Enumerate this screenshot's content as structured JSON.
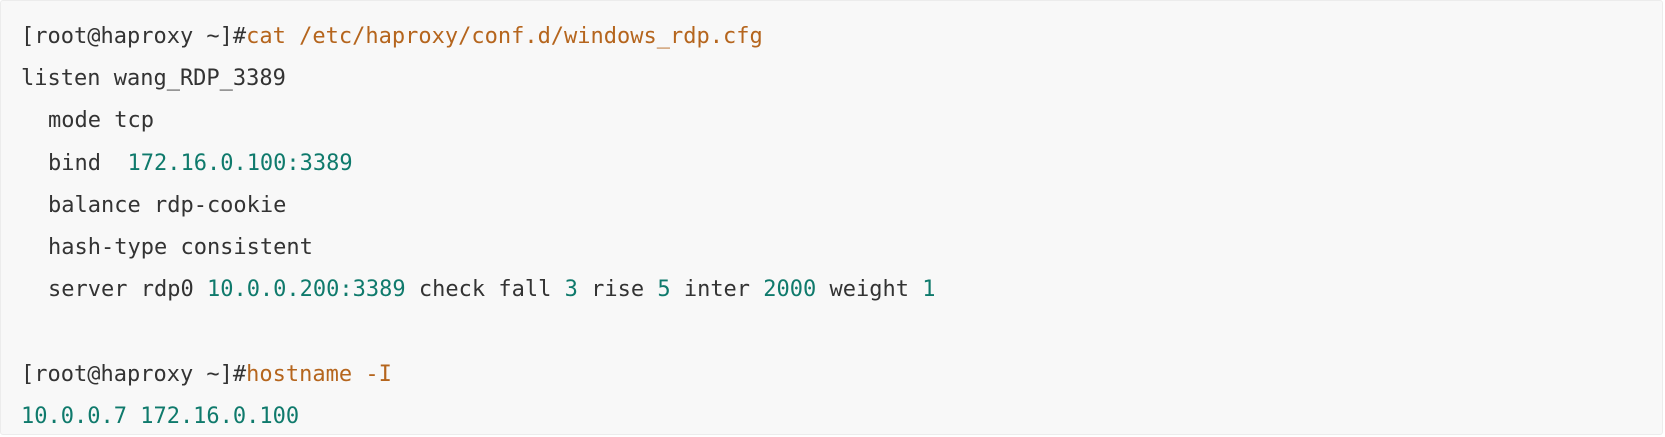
{
  "code": {
    "prompt1": "[root@haproxy ~]#",
    "command1": "cat /etc/haproxy/conf.d/windows_rdp.cfg",
    "listen_line": "listen wang_RDP_3389",
    "mode_line": "mode tcp",
    "bind_keyword": "bind  ",
    "bind_address": "172.16.0.100:3389",
    "balance_line": "balance rdp-cookie",
    "hash_line": "hash-type consistent",
    "server": {
      "prefix": "server rdp0 ",
      "address": "10.0.0.200:3389",
      "check_fall": " check fall ",
      "fall": "3",
      "rise_label": " rise ",
      "rise": "5",
      "inter_label": " inter ",
      "inter": "2000",
      "weight_label": " weight ",
      "weight": "1"
    },
    "prompt2": "[root@haproxy ~]#",
    "command2": "hostname -I",
    "output_ips": "10.0.0.7 172.16.0.100"
  }
}
